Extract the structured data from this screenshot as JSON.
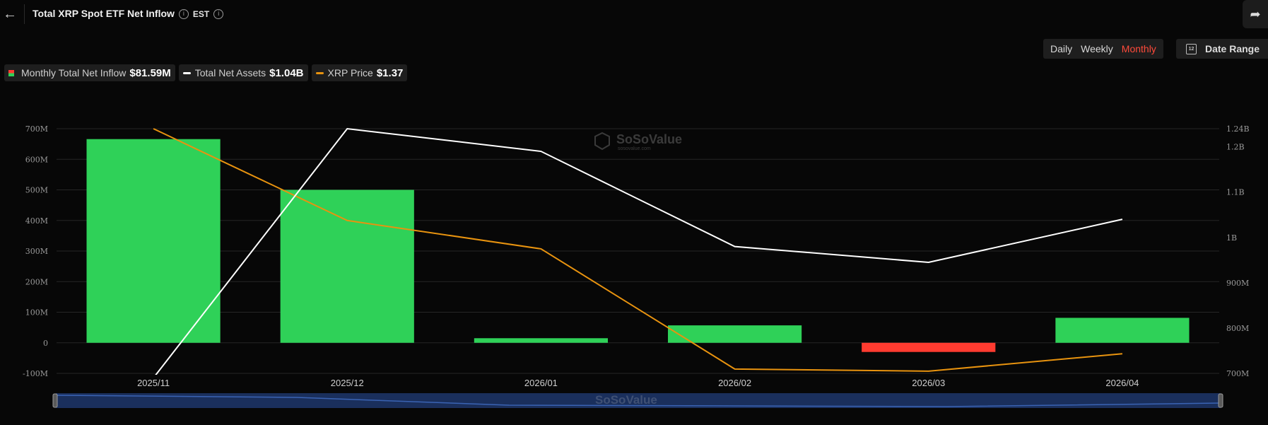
{
  "header": {
    "title": "Total XRP Spot ETF Net Inflow",
    "timezone": "EST"
  },
  "period": {
    "options": [
      "Daily",
      "Weekly",
      "Monthly"
    ],
    "selected": "Monthly"
  },
  "date_range_label": "Date Range",
  "legend": [
    {
      "label": "Monthly Total Net Inflow",
      "value": "$81.59M",
      "kind": "bar"
    },
    {
      "label": "Total Net Assets",
      "value": "$1.04B",
      "kind": "line",
      "color": "#ffffff"
    },
    {
      "label": "XRP Price",
      "value": "$1.37",
      "kind": "line",
      "color": "#e8930f"
    }
  ],
  "watermark": {
    "brand": "SoSoValue",
    "sub": "sosovalue.com"
  },
  "colors": {
    "positive": "#2fd158",
    "negative": "#ff3b30",
    "assets": "#ffffff",
    "price": "#e8930f",
    "navigator": "#1a2f5c"
  },
  "chart_data": {
    "type": "bar",
    "categories": [
      "2025/11",
      "2025/12",
      "2026/01",
      "2026/02",
      "2026/03",
      "2026/04"
    ],
    "series": [
      {
        "name": "Monthly Total Net Inflow",
        "type": "bar",
        "axis": "left",
        "values": [
          666000000,
          500000000,
          15000000,
          57000000,
          -30000000,
          81590000
        ]
      },
      {
        "name": "Total Net Assets",
        "type": "line",
        "axis": "right",
        "values": [
          690000000,
          1240000000,
          1190000000,
          980000000,
          945000000,
          1040000000
        ]
      },
      {
        "name": "XRP Price",
        "type": "line",
        "axis": "right2",
        "values": [
          2.4,
          1.98,
          1.85,
          1.3,
          1.29,
          1.37
        ]
      }
    ],
    "left_axis": {
      "ylim": [
        -100000000,
        700000000
      ],
      "ticks": [
        {
          "v": -100000000,
          "label": "-100M"
        },
        {
          "v": 0,
          "label": "0"
        },
        {
          "v": 100000000,
          "label": "100M"
        },
        {
          "v": 200000000,
          "label": "200M"
        },
        {
          "v": 300000000,
          "label": "300M"
        },
        {
          "v": 400000000,
          "label": "400M"
        },
        {
          "v": 500000000,
          "label": "500M"
        },
        {
          "v": 600000000,
          "label": "600M"
        },
        {
          "v": 700000000,
          "label": "700M"
        }
      ]
    },
    "right_axis": {
      "ylim": [
        700000000,
        1240000000
      ],
      "ticks": [
        {
          "v": 700000000,
          "label": "700M"
        },
        {
          "v": 800000000,
          "label": "800M"
        },
        {
          "v": 900000000,
          "label": "900M"
        },
        {
          "v": 1000000000,
          "label": "1B"
        },
        {
          "v": 1100000000,
          "label": "1.1B"
        },
        {
          "v": 1200000000,
          "label": "1.2B"
        },
        {
          "v": 1240000000,
          "label": "1.24B"
        }
      ]
    },
    "price_axis": {
      "ylim": [
        1.28,
        2.4
      ]
    },
    "grid": true,
    "legend_position": "top-left"
  }
}
